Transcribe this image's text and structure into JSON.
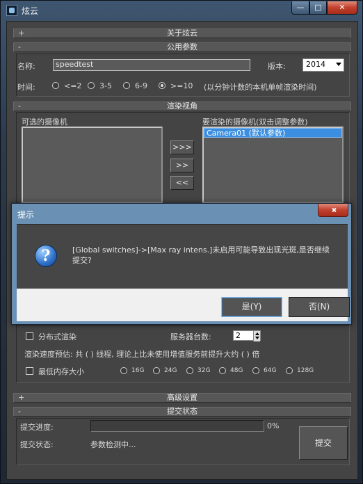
{
  "window": {
    "title": "炫云",
    "min": "—",
    "max": "□",
    "close": "✕"
  },
  "about": {
    "sign": "+",
    "title": "关于炫云"
  },
  "common": {
    "sign": "-",
    "title": "公用参数",
    "name_label": "名称:",
    "name_value": "speedtest",
    "version_label": "版本:",
    "version_value": "2014",
    "time_label": "时间:",
    "time_options": [
      "<=2",
      "3-5",
      "6-9",
      ">=10"
    ],
    "time_selected": 3,
    "time_note": "(以分钟计数的本机单帧渲染时间)"
  },
  "render_view": {
    "sign": "-",
    "title": "渲染视角",
    "available_label": "可选的摄像机",
    "selected_label": "要渲染的摄像机(双击调整参数)",
    "selected_items": [
      "Camera01 (默认参数)"
    ],
    "btn_all": ">>>",
    "btn_add": ">>",
    "btn_remove": "<<"
  },
  "render_opts": {
    "distributed_label": "分布式渲染",
    "server_count_label": "服务器台数:",
    "server_count_value": "2",
    "estimate_text": "渲染速度预估: 共 ( ) 线程, 理论上比未使用增值服务前提升大约 ( ) 倍",
    "min_memory_label": "最低内存大小",
    "memory_options": [
      "16G",
      "24G",
      "32G",
      "48G",
      "64G",
      "128G"
    ]
  },
  "advanced": {
    "sign": "+",
    "title": "高级设置"
  },
  "submit": {
    "sign": "-",
    "title": "提交状态",
    "progress_label": "提交进度:",
    "progress_value": 0,
    "progress_text": "0%",
    "status_label": "提交状态:",
    "status_value": "参数检测中...",
    "submit_btn": "提交"
  },
  "dialog": {
    "title": "提示",
    "message": "[Global switches]->[Max ray intens.]未启用可能导致出现光斑,是否继续提交?",
    "icon": "question-icon",
    "yes": "是(Y)",
    "no": "否(N)"
  }
}
